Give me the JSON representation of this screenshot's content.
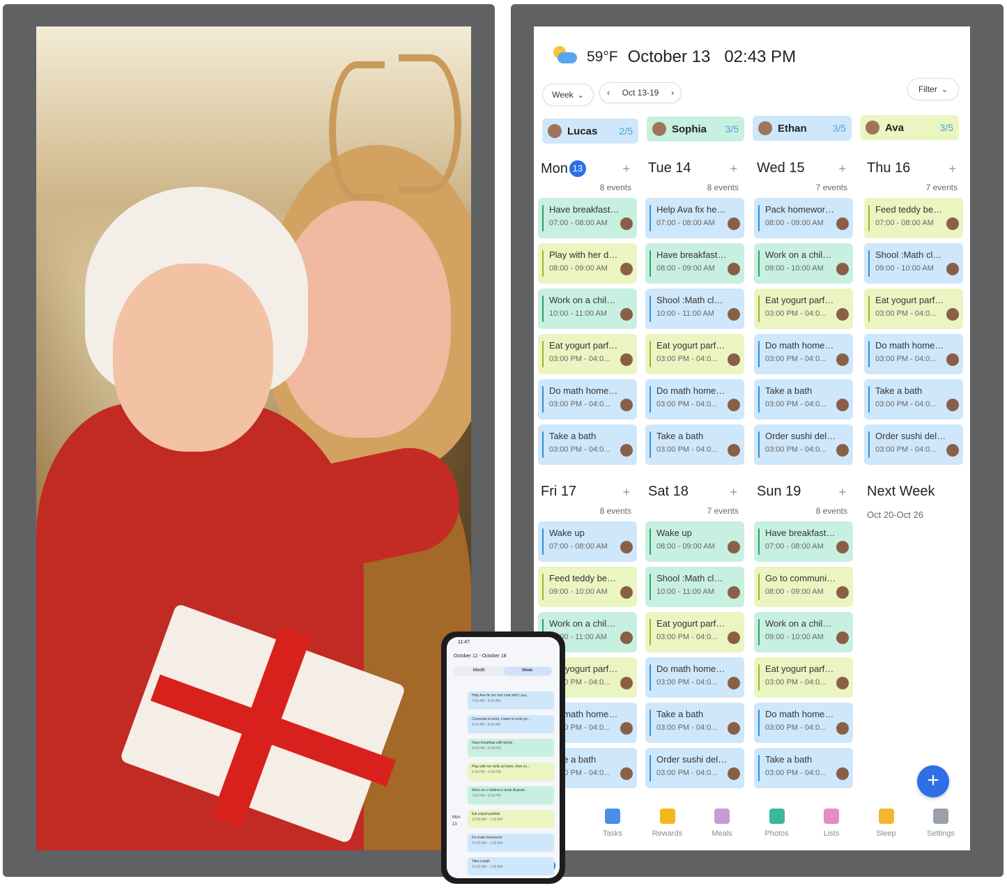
{
  "header": {
    "temperature": "59°F",
    "date": "October 13",
    "time": "02:43 PM"
  },
  "controls": {
    "view": "Week",
    "range": "Oct 13-19",
    "filter": "Filter"
  },
  "people": [
    {
      "name": "Lucas",
      "count": "2/5",
      "color": "#cfe7fa"
    },
    {
      "name": "Sophia",
      "count": "3/5",
      "color": "#c8f0e0"
    },
    {
      "name": "Ethan",
      "count": "3/5",
      "color": "#cfe7fa"
    },
    {
      "name": "Ava",
      "count": "3/5",
      "color": "#eaf5c1"
    }
  ],
  "days": [
    {
      "name": "Mon",
      "badge": "13",
      "count": "8 events",
      "events": [
        {
          "title": "Have breakfast wi...",
          "time": "07:00 - 08:00 AM",
          "color": "green"
        },
        {
          "title": "Play with her doll...",
          "time": "08:00 - 09:00 AM",
          "color": "yellow"
        },
        {
          "title": "Work on a childre...",
          "time": "10:00 - 11:00 AM",
          "color": "green"
        },
        {
          "title": "Eat yogurt parfaits",
          "time": "03:00 PM - 04:0...",
          "color": "yellow"
        },
        {
          "title": "Do math homewo...",
          "time": "03:00 PM - 04:0...",
          "color": "blue"
        },
        {
          "title": "Take a bath",
          "time": "03:00 PM - 04:0...",
          "color": "blue"
        }
      ]
    },
    {
      "name": "Tue 14",
      "badge": "",
      "count": "8 events",
      "events": [
        {
          "title": "Help Ava fix her h...",
          "time": "07:00 - 08:00 AM",
          "color": "blue"
        },
        {
          "title": "Have breakfast wi...",
          "time": "08:00 - 09:00 AM",
          "color": "green"
        },
        {
          "title": "Shool :Math class...",
          "time": "10:00 - 11:00 AM",
          "color": "blue"
        },
        {
          "title": "Eat yogurt parfaits",
          "time": "03:00 PM - 04:0...",
          "color": "yellow"
        },
        {
          "title": "Do math homewo...",
          "time": "03:00 PM - 04:0...",
          "color": "blue"
        },
        {
          "title": "Take a bath",
          "time": "03:00 PM - 04:0...",
          "color": "blue"
        }
      ]
    },
    {
      "name": "Wed 15",
      "badge": "",
      "count": "7 events",
      "events": [
        {
          "title": "Pack homework i...",
          "time": "08:00 - 09:00 AM",
          "color": "blue"
        },
        {
          "title": "Work on a childre...",
          "time": "09:00 - 10:00 AM",
          "color": "green"
        },
        {
          "title": "Eat yogurt parfaits",
          "time": "03:00 PM - 04:0...",
          "color": "yellow"
        },
        {
          "title": "Do math homewo...",
          "time": "03:00 PM - 04:0...",
          "color": "blue"
        },
        {
          "title": "Take a bath",
          "time": "03:00 PM - 04:0...",
          "color": "blue"
        },
        {
          "title": "Order sushi delive...",
          "time": "03:00 PM - 04:0...",
          "color": "blue"
        }
      ]
    },
    {
      "name": "Thu 16",
      "badge": "",
      "count": "7 events",
      "events": [
        {
          "title": "Feed teddy bear\"p...",
          "time": "07:00 - 08:00 AM",
          "color": "yellow"
        },
        {
          "title": "Shool :Math class...",
          "time": "09:00 - 10:00 AM",
          "color": "blue"
        },
        {
          "title": "Eat yogurt parfaits",
          "time": "03:00 PM - 04:0...",
          "color": "yellow"
        },
        {
          "title": "Do math homewo...",
          "time": "03:00 PM - 04:0...",
          "color": "blue"
        },
        {
          "title": "Take a bath",
          "time": "03:00 PM - 04:0...",
          "color": "blue"
        },
        {
          "title": "Order sushi delive...",
          "time": "03:00 PM - 04:0...",
          "color": "blue"
        }
      ]
    },
    {
      "name": "Fri 17",
      "badge": "",
      "count": "8 events",
      "events": [
        {
          "title": "Wake up",
          "time": "07:00 - 08:00 AM",
          "color": "blue"
        },
        {
          "title": "Feed teddy bear\"p...",
          "time": "09:00 - 10:00 AM",
          "color": "yellow"
        },
        {
          "title": "Work on a childre...",
          "time": "10:00 - 11:00 AM",
          "color": "green"
        },
        {
          "title": "Eat yogurt parfaits",
          "time": "03:00 PM - 04:0...",
          "color": "yellow"
        },
        {
          "title": "Do math homewo...",
          "time": "03:00 PM - 04:0...",
          "color": "blue"
        },
        {
          "title": "Take a bath",
          "time": "03:00 PM - 04:0...",
          "color": "blue"
        }
      ]
    },
    {
      "name": "Sat 18",
      "badge": "",
      "count": "7 events",
      "events": [
        {
          "title": "Wake up",
          "time": "08:00 - 09:00 AM",
          "color": "green"
        },
        {
          "title": "Shool :Math class...",
          "time": "10:00 - 11:00 AM",
          "color": "green"
        },
        {
          "title": "Eat yogurt parfaits",
          "time": "03:00 PM - 04:0...",
          "color": "yellow"
        },
        {
          "title": "Do math homewo...",
          "time": "03:00 PM - 04:0...",
          "color": "blue"
        },
        {
          "title": "Take a bath",
          "time": "03:00 PM - 04:0...",
          "color": "blue"
        },
        {
          "title": "Order sushi delive...",
          "time": "03:00 PM - 04:0...",
          "color": "blue"
        }
      ]
    },
    {
      "name": "Sun 19",
      "badge": "",
      "count": "8 events",
      "events": [
        {
          "title": "Have breakfast wi...",
          "time": "07:00 - 08:00 AM",
          "color": "green"
        },
        {
          "title": "Go to community...",
          "time": "08:00 - 09:00 AM",
          "color": "yellow"
        },
        {
          "title": "Work on a childre...",
          "time": "09:00 - 10:00 AM",
          "color": "green"
        },
        {
          "title": "Eat yogurt parfaits",
          "time": "03:00 PM - 04:0...",
          "color": "yellow"
        },
        {
          "title": "Do math homewo...",
          "time": "03:00 PM - 04:0...",
          "color": "blue"
        },
        {
          "title": "Take a bath",
          "time": "03:00 PM - 04:0...",
          "color": "blue"
        }
      ]
    }
  ],
  "next_week": {
    "title": "Next Week",
    "range": "Oct 20-Oct 26"
  },
  "fab": "+",
  "tabs": [
    {
      "label": "dar",
      "icon": "calendar-icon",
      "color": "#2e6fe6"
    },
    {
      "label": "Tasks",
      "icon": "checkbox-icon",
      "color": "#4a8ee8"
    },
    {
      "label": "Rewards",
      "icon": "star-icon",
      "color": "#f5b81c"
    },
    {
      "label": "Meals",
      "icon": "fork-knife-icon",
      "color": "#c79bd8"
    },
    {
      "label": "Photos",
      "icon": "photo-icon",
      "color": "#3bb89a"
    },
    {
      "label": "Lists",
      "icon": "list-icon",
      "color": "#e48bc8"
    },
    {
      "label": "Sleep",
      "icon": "moon-icon",
      "color": "#f4b731"
    },
    {
      "label": "Settings",
      "icon": "gear-icon",
      "color": "#9aa0a8"
    }
  ],
  "phone": {
    "status_time": "11:47",
    "title": "October 12 - October 18",
    "segments": [
      "Month",
      "Week"
    ],
    "day_label": "Mon",
    "day_number": "13",
    "events": [
      {
        "title": "Help Ava fix her hair chat with Luca...",
        "time": "7:00 AM - 8:00 AM",
        "color": "#cfe7fa"
      },
      {
        "title": "Commute to work. Listen to work po...",
        "time": "8:00 AM - 8:00 AM",
        "color": "#cfe7fa"
      },
      {
        "title": "Have breakfast with family",
        "time": "4:00 PM - 5:30 PM",
        "color": "#c8f0e0"
      },
      {
        "title": "Play with her dolls at home, then co...",
        "time": "5:30 PM - 6:00 PM",
        "color": "#eaf5c1"
      },
      {
        "title": "Work on a children's book illustrati...",
        "time": "7:00 PM - 8:30 PM",
        "color": "#c8f0e0"
      },
      {
        "title": "Eat yogurt parfaits",
        "time": "12:00 AM - 1:30 AM",
        "color": "#eaf5c1"
      },
      {
        "title": "Do math homework",
        "time": "12:00 AM - 1:00 AM",
        "color": "#cfe7fa"
      },
      {
        "title": "Take a bath",
        "time": "12:00 AM - 1:00 AM",
        "color": "#cfe7fa"
      }
    ],
    "fab": "+"
  }
}
